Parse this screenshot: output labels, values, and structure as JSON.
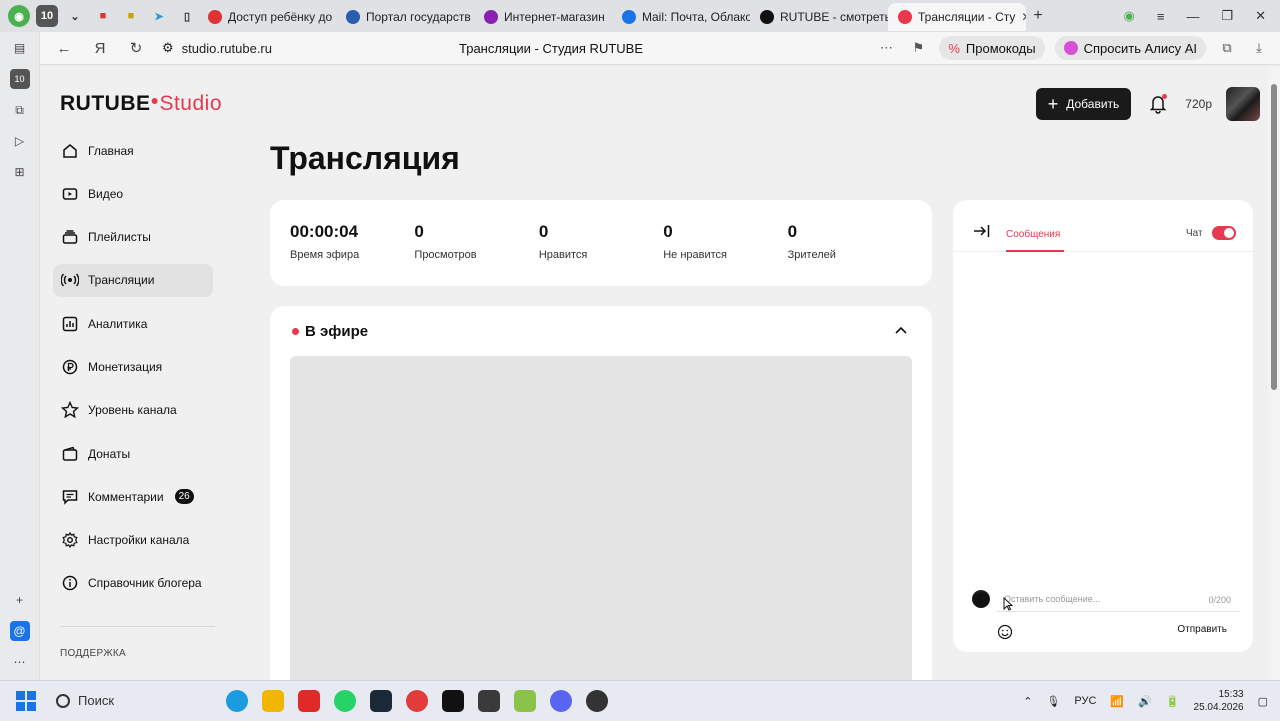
{
  "browser": {
    "tabs": [
      {
        "label": "Доступ ребёнку до",
        "color": "#d33"
      },
      {
        "label": "Портал государств",
        "color": "#2a5db0"
      },
      {
        "label": "Интернет-магазин",
        "color": "#8b1fb0"
      },
      {
        "label": "Mail: Почта, Облако",
        "color": "#1a73e8"
      },
      {
        "label": "RUTUBE - смотреть",
        "color": "#111"
      },
      {
        "label": "Трансляции - Сту",
        "color": "#e8384f"
      }
    ],
    "lead_icons": [
      "10"
    ],
    "url": "studio.rutube.ru",
    "page_title": "Трансляции - Студия RUTUBE",
    "promo_label": "Промокоды",
    "alice_label": "Спросить Алису AI"
  },
  "studio": {
    "logo_main": "RUTUBE",
    "logo_studio": "Studio",
    "heading": "Трансляция",
    "add_button": "Добавить",
    "quality": "720p",
    "sidebar": [
      {
        "label": "Главная",
        "icon": "home-icon"
      },
      {
        "label": "Видео",
        "icon": "video-icon"
      },
      {
        "label": "Плейлисты",
        "icon": "playlist-icon"
      },
      {
        "label": "Трансляции",
        "icon": "broadcast-icon",
        "active": true
      },
      {
        "label": "Аналитика",
        "icon": "analytics-icon"
      },
      {
        "label": "Монетизация",
        "icon": "ruble-icon"
      },
      {
        "label": "Уровень канала",
        "icon": "star-icon"
      },
      {
        "label": "Донаты",
        "icon": "donate-icon"
      },
      {
        "label": "Комментарии",
        "icon": "comment-icon",
        "badge": "26"
      },
      {
        "label": "Настройки канала",
        "icon": "gear-icon"
      },
      {
        "label": "Справочник блогера",
        "icon": "info-icon"
      }
    ],
    "support_label": "ПОДДЕРЖКА",
    "stats": [
      {
        "value": "00:00:04",
        "label": "Время эфира"
      },
      {
        "value": "0",
        "label": "Просмотров"
      },
      {
        "value": "0",
        "label": "Нравится"
      },
      {
        "value": "0",
        "label": "Не нравится"
      },
      {
        "value": "0",
        "label": "Зрителей"
      }
    ],
    "live_label": "В эфире",
    "chat": {
      "tab_label": "Сообщения",
      "chat_label": "Чат",
      "input_placeholder": "Оставить сообщение...",
      "counter": "0/200",
      "send_label": "Отправить"
    }
  },
  "taskbar": {
    "search_label": "Поиск",
    "lang": "РУС",
    "time": "15:33",
    "date": "25.04.2026"
  }
}
